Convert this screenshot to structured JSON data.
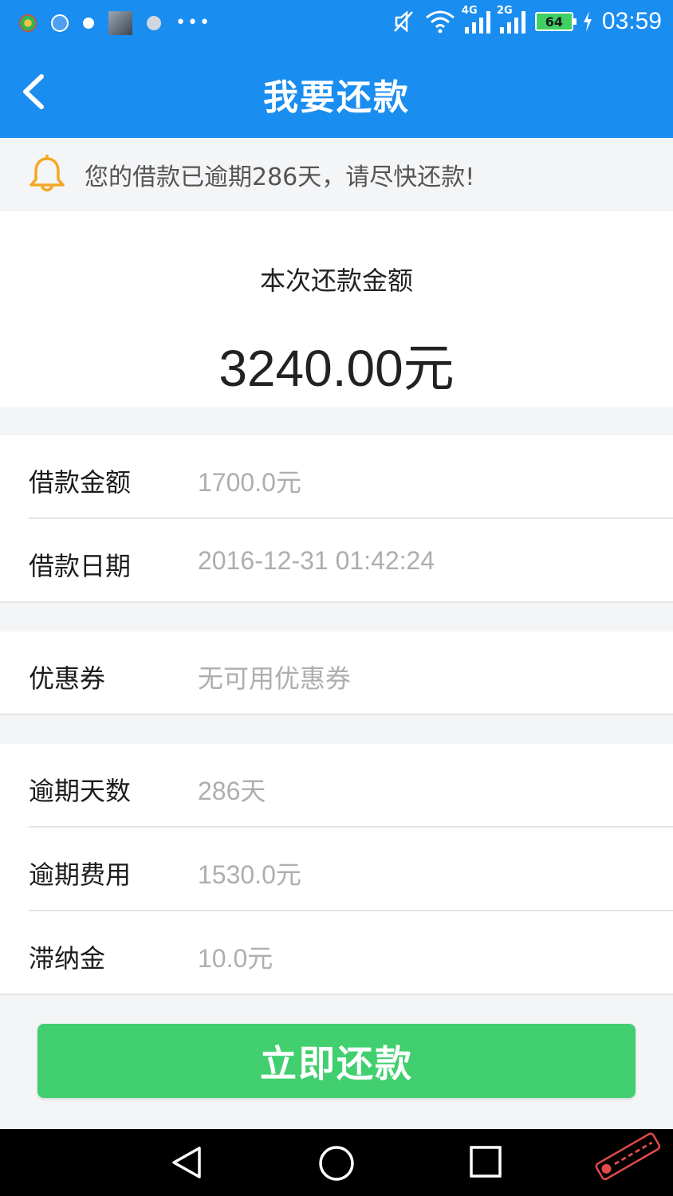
{
  "status_bar": {
    "time": "03:59",
    "battery": "64",
    "network_1": "4G",
    "network_2": "2G"
  },
  "header": {
    "title": "我要还款"
  },
  "notice": {
    "text": "您的借款已逾期286天，请尽快还款!"
  },
  "summary": {
    "label": "本次还款金额",
    "amount": "3240.00元"
  },
  "loan_info": [
    {
      "label": "借款金额",
      "value": "1700.0元"
    },
    {
      "label": "借款日期",
      "value": "2016-12-31 01:42:24"
    }
  ],
  "coupon": {
    "label": "优惠券",
    "value": "无可用优惠券"
  },
  "overdue_info": [
    {
      "label": "逾期天数",
      "value": "286天"
    },
    {
      "label": "逾期费用",
      "value": "1530.0元"
    },
    {
      "label": "滞纳金",
      "value": "10.0元"
    }
  ],
  "actions": {
    "pay_now": "立即还款"
  },
  "colors": {
    "primary": "#1a8df0",
    "button": "#41cf6f",
    "bell": "#f5a623"
  }
}
